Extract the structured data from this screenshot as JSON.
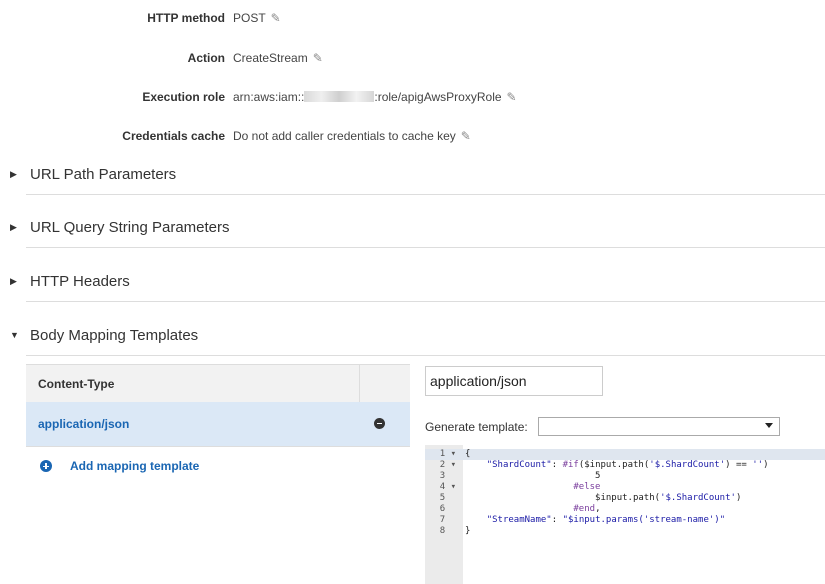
{
  "details": {
    "http_method": {
      "label": "HTTP method",
      "value": "POST"
    },
    "action": {
      "label": "Action",
      "value": "CreateStream"
    },
    "execution_role": {
      "label": "Execution role",
      "prefix": "arn:aws:iam::",
      "suffix": ":role/apigAwsProxyRole"
    },
    "credentials_cache": {
      "label": "Credentials cache",
      "value": "Do not add caller credentials to cache key"
    }
  },
  "sections": {
    "url_path": "URL Path Parameters",
    "url_query": "URL Query String Parameters",
    "http_headers": "HTTP Headers",
    "body_mapping": "Body Mapping Templates"
  },
  "content_table": {
    "header": "Content-Type",
    "rows": [
      "application/json"
    ],
    "add_label": "Add mapping template"
  },
  "editor_panel": {
    "content_type_value": "application/json",
    "generate_label": "Generate template:",
    "generate_selected": ""
  },
  "code": {
    "lines": [
      {
        "n": "1",
        "fold": true,
        "text": "{"
      },
      {
        "n": "2",
        "fold": true,
        "text": "    \"ShardCount\": #if($input.path('$.ShardCount') == '')"
      },
      {
        "n": "3",
        "fold": false,
        "text": "                        5"
      },
      {
        "n": "4",
        "fold": true,
        "text": "                    #else"
      },
      {
        "n": "5",
        "fold": false,
        "text": "                        $input.path('$.ShardCount')"
      },
      {
        "n": "6",
        "fold": false,
        "text": "                    #end,"
      },
      {
        "n": "7",
        "fold": false,
        "text": "    \"StreamName\": \"$input.params('stream-name')\""
      },
      {
        "n": "8",
        "fold": false,
        "text": "}"
      }
    ]
  },
  "icons": {
    "edit": "pencil-icon",
    "collapsed": "caret-right-icon",
    "expanded": "caret-down-icon",
    "remove": "minus-circle-icon",
    "add": "plus-circle-icon"
  },
  "colors": {
    "link": "#1a66b3",
    "selected_row": "#dbe8f6"
  }
}
